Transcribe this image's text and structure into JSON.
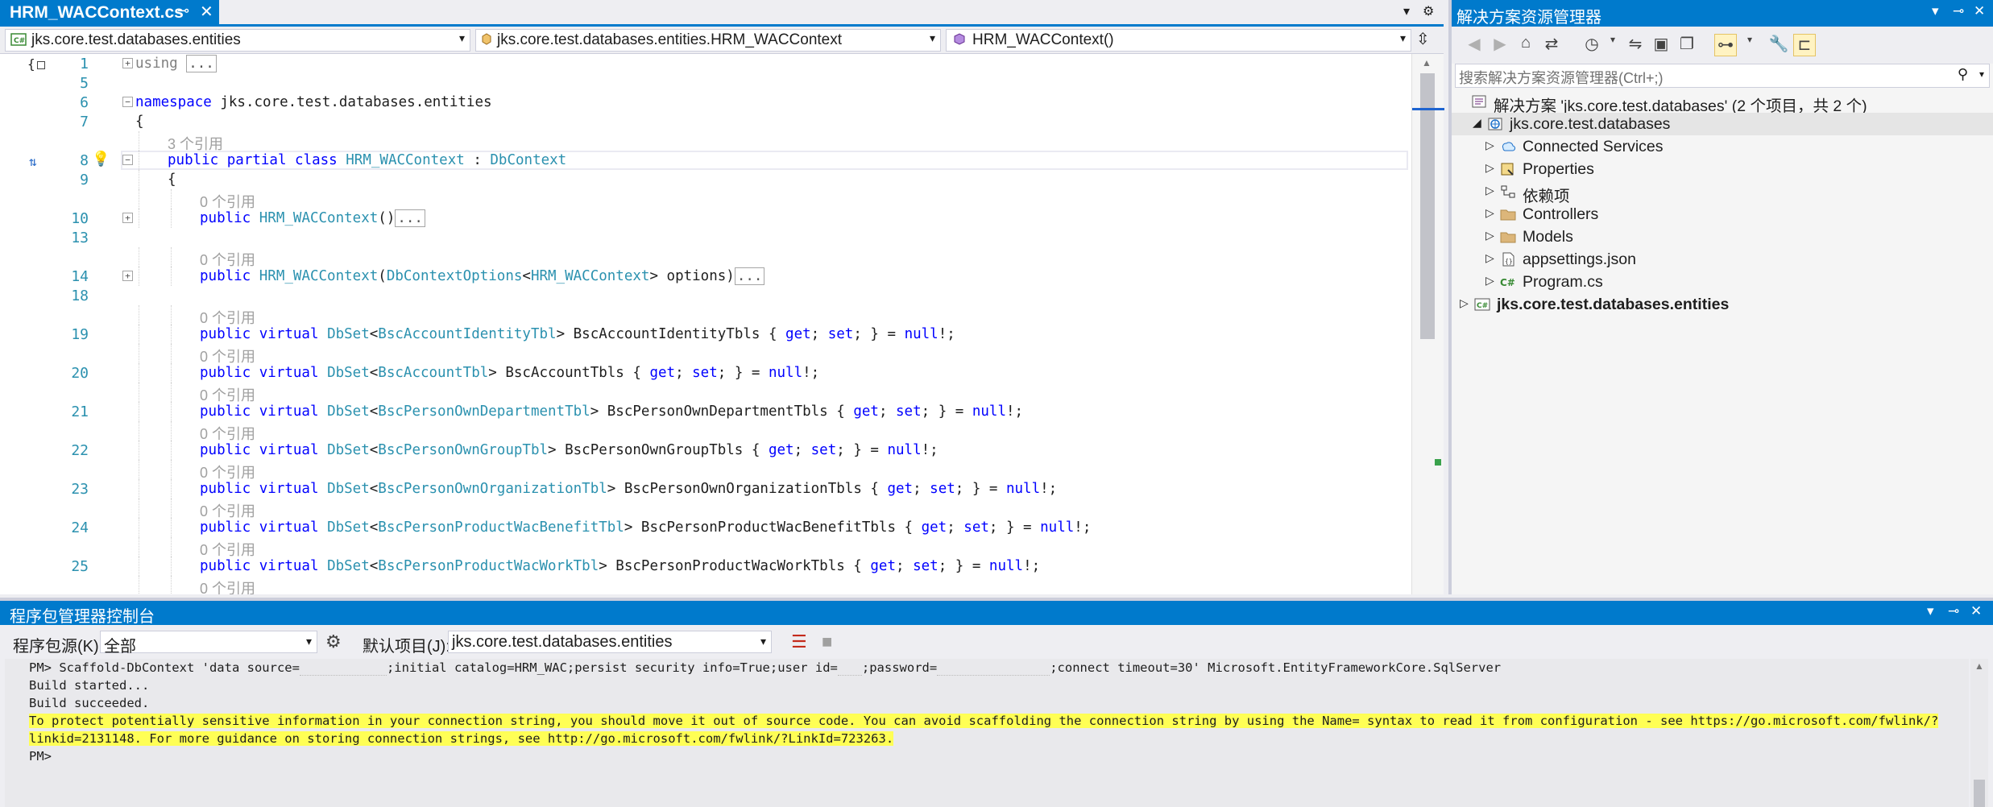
{
  "editor": {
    "tab_title": "HRM_WACContext.cs",
    "nav_project": "jks.core.test.databases.entities",
    "nav_class": "jks.core.test.databases.entities.HRM_WACContext",
    "nav_member": "HRM_WACContext()",
    "lines": [
      {
        "num": "1",
        "kind": "code",
        "fold": "+",
        "html_parts": [
          {
            "c": "dim",
            "t": "using "
          },
          {
            "c": "collapsed",
            "t": "..."
          }
        ]
      },
      {
        "num": "5",
        "kind": "blank"
      },
      {
        "num": "6",
        "kind": "code",
        "fold": "-",
        "html_parts": [
          {
            "c": "kw",
            "t": "namespace"
          },
          {
            "c": "",
            "t": " jks.core.test.databases.entities"
          }
        ]
      },
      {
        "num": "7",
        "kind": "code",
        "html_parts": [
          {
            "c": "",
            "t": "{"
          }
        ]
      },
      {
        "kind": "refs",
        "indent": 1,
        "text": "3 个引用"
      },
      {
        "num": "8",
        "kind": "code",
        "fold": "-",
        "current": true,
        "indent": 1,
        "html_parts": [
          {
            "c": "kw",
            "t": "public partial class"
          },
          {
            "c": "",
            "t": " "
          },
          {
            "c": "ty",
            "t": "HRM_WACContext"
          },
          {
            "c": "",
            "t": " : "
          },
          {
            "c": "ty",
            "t": "DbContext"
          }
        ]
      },
      {
        "num": "9",
        "kind": "code",
        "indent": 1,
        "html_parts": [
          {
            "c": "",
            "t": "{"
          }
        ]
      },
      {
        "kind": "refs",
        "indent": 2,
        "text": "0 个引用"
      },
      {
        "num": "10",
        "kind": "code",
        "fold": "+",
        "indent": 2,
        "html_parts": [
          {
            "c": "kw",
            "t": "public"
          },
          {
            "c": "",
            "t": " "
          },
          {
            "c": "ty",
            "t": "HRM_WACContext"
          },
          {
            "c": "",
            "t": "()"
          },
          {
            "c": "collapsed",
            "t": "..."
          }
        ]
      },
      {
        "num": "13",
        "kind": "blank"
      },
      {
        "kind": "refs",
        "indent": 2,
        "text": "0 个引用"
      },
      {
        "num": "14",
        "kind": "code",
        "fold": "+",
        "indent": 2,
        "html_parts": [
          {
            "c": "kw",
            "t": "public"
          },
          {
            "c": "",
            "t": " "
          },
          {
            "c": "ty",
            "t": "HRM_WACContext"
          },
          {
            "c": "",
            "t": "("
          },
          {
            "c": "ty",
            "t": "DbContextOptions"
          },
          {
            "c": "",
            "t": "<"
          },
          {
            "c": "ty",
            "t": "HRM_WACContext"
          },
          {
            "c": "",
            "t": "> options)"
          },
          {
            "c": "collapsed",
            "t": "..."
          }
        ]
      },
      {
        "num": "18",
        "kind": "blank"
      },
      {
        "kind": "refs",
        "indent": 2,
        "text": "0 个引用"
      },
      {
        "num": "19",
        "kind": "code",
        "indent": 2,
        "html_parts": [
          {
            "c": "kw",
            "t": "public virtual"
          },
          {
            "c": "",
            "t": " "
          },
          {
            "c": "ty",
            "t": "DbSet"
          },
          {
            "c": "",
            "t": "<"
          },
          {
            "c": "ty",
            "t": "BscAccountIdentityTbl"
          },
          {
            "c": "",
            "t": "> BscAccountIdentityTbls { "
          },
          {
            "c": "kw",
            "t": "get"
          },
          {
            "c": "",
            "t": "; "
          },
          {
            "c": "kw",
            "t": "set"
          },
          {
            "c": "",
            "t": "; } = "
          },
          {
            "c": "kw",
            "t": "null"
          },
          {
            "c": "",
            "t": "!;"
          }
        ]
      },
      {
        "kind": "refs",
        "indent": 2,
        "text": "0 个引用"
      },
      {
        "num": "20",
        "kind": "code",
        "indent": 2,
        "html_parts": [
          {
            "c": "kw",
            "t": "public virtual"
          },
          {
            "c": "",
            "t": " "
          },
          {
            "c": "ty",
            "t": "DbSet"
          },
          {
            "c": "",
            "t": "<"
          },
          {
            "c": "ty",
            "t": "BscAccountTbl"
          },
          {
            "c": "",
            "t": "> BscAccountTbls { "
          },
          {
            "c": "kw",
            "t": "get"
          },
          {
            "c": "",
            "t": "; "
          },
          {
            "c": "kw",
            "t": "set"
          },
          {
            "c": "",
            "t": "; } = "
          },
          {
            "c": "kw",
            "t": "null"
          },
          {
            "c": "",
            "t": "!;"
          }
        ]
      },
      {
        "kind": "refs",
        "indent": 2,
        "text": "0 个引用"
      },
      {
        "num": "21",
        "kind": "code",
        "indent": 2,
        "html_parts": [
          {
            "c": "kw",
            "t": "public virtual"
          },
          {
            "c": "",
            "t": " "
          },
          {
            "c": "ty",
            "t": "DbSet"
          },
          {
            "c": "",
            "t": "<"
          },
          {
            "c": "ty",
            "t": "BscPersonOwnDepartmentTbl"
          },
          {
            "c": "",
            "t": "> BscPersonOwnDepartmentTbls { "
          },
          {
            "c": "kw",
            "t": "get"
          },
          {
            "c": "",
            "t": "; "
          },
          {
            "c": "kw",
            "t": "set"
          },
          {
            "c": "",
            "t": "; } = "
          },
          {
            "c": "kw",
            "t": "null"
          },
          {
            "c": "",
            "t": "!;"
          }
        ]
      },
      {
        "kind": "refs",
        "indent": 2,
        "text": "0 个引用"
      },
      {
        "num": "22",
        "kind": "code",
        "indent": 2,
        "html_parts": [
          {
            "c": "kw",
            "t": "public virtual"
          },
          {
            "c": "",
            "t": " "
          },
          {
            "c": "ty",
            "t": "DbSet"
          },
          {
            "c": "",
            "t": "<"
          },
          {
            "c": "ty",
            "t": "BscPersonOwnGroupTbl"
          },
          {
            "c": "",
            "t": "> BscPersonOwnGroupTbls { "
          },
          {
            "c": "kw",
            "t": "get"
          },
          {
            "c": "",
            "t": "; "
          },
          {
            "c": "kw",
            "t": "set"
          },
          {
            "c": "",
            "t": "; } = "
          },
          {
            "c": "kw",
            "t": "null"
          },
          {
            "c": "",
            "t": "!;"
          }
        ]
      },
      {
        "kind": "refs",
        "indent": 2,
        "text": "0 个引用"
      },
      {
        "num": "23",
        "kind": "code",
        "indent": 2,
        "html_parts": [
          {
            "c": "kw",
            "t": "public virtual"
          },
          {
            "c": "",
            "t": " "
          },
          {
            "c": "ty",
            "t": "DbSet"
          },
          {
            "c": "",
            "t": "<"
          },
          {
            "c": "ty",
            "t": "BscPersonOwnOrganizationTbl"
          },
          {
            "c": "",
            "t": "> BscPersonOwnOrganizationTbls { "
          },
          {
            "c": "kw",
            "t": "get"
          },
          {
            "c": "",
            "t": "; "
          },
          {
            "c": "kw",
            "t": "set"
          },
          {
            "c": "",
            "t": "; } = "
          },
          {
            "c": "kw",
            "t": "null"
          },
          {
            "c": "",
            "t": "!;"
          }
        ]
      },
      {
        "kind": "refs",
        "indent": 2,
        "text": "0 个引用"
      },
      {
        "num": "24",
        "kind": "code",
        "indent": 2,
        "html_parts": [
          {
            "c": "kw",
            "t": "public virtual"
          },
          {
            "c": "",
            "t": " "
          },
          {
            "c": "ty",
            "t": "DbSet"
          },
          {
            "c": "",
            "t": "<"
          },
          {
            "c": "ty",
            "t": "BscPersonProductWacBenefitTbl"
          },
          {
            "c": "",
            "t": "> BscPersonProductWacBenefitTbls { "
          },
          {
            "c": "kw",
            "t": "get"
          },
          {
            "c": "",
            "t": "; "
          },
          {
            "c": "kw",
            "t": "set"
          },
          {
            "c": "",
            "t": "; } = "
          },
          {
            "c": "kw",
            "t": "null"
          },
          {
            "c": "",
            "t": "!;"
          }
        ]
      },
      {
        "kind": "refs",
        "indent": 2,
        "text": "0 个引用"
      },
      {
        "num": "25",
        "kind": "code",
        "indent": 2,
        "html_parts": [
          {
            "c": "kw",
            "t": "public virtual"
          },
          {
            "c": "",
            "t": " "
          },
          {
            "c": "ty",
            "t": "DbSet"
          },
          {
            "c": "",
            "t": "<"
          },
          {
            "c": "ty",
            "t": "BscPersonProductWacWorkTbl"
          },
          {
            "c": "",
            "t": "> BscPersonProductWacWorkTbls { "
          },
          {
            "c": "kw",
            "t": "get"
          },
          {
            "c": "",
            "t": "; "
          },
          {
            "c": "kw",
            "t": "set"
          },
          {
            "c": "",
            "t": "; } = "
          },
          {
            "c": "kw",
            "t": "null"
          },
          {
            "c": "",
            "t": "!;"
          }
        ]
      },
      {
        "kind": "refs",
        "indent": 2,
        "text": "0 个引用"
      }
    ]
  },
  "solution_explorer": {
    "title": "解决方案资源管理器",
    "search_placeholder": "搜索解决方案资源管理器(Ctrl+;)",
    "tree": [
      {
        "label": "解决方案 'jks.core.test.databases' (2 个项目，共 2 个)",
        "level": 0,
        "icon": "solution-icon",
        "expander": "",
        "bold": false
      },
      {
        "label": "jks.core.test.databases",
        "level": 0,
        "icon": "web-project-icon",
        "expander": "◢",
        "bold": false,
        "selected": true
      },
      {
        "label": "Connected Services",
        "level": 1,
        "icon": "connected-services-icon",
        "expander": "▷",
        "bold": false
      },
      {
        "label": "Properties",
        "level": 1,
        "icon": "properties-icon",
        "expander": "▷",
        "bold": false
      },
      {
        "label": "依赖项",
        "level": 1,
        "icon": "dependencies-icon",
        "expander": "▷",
        "bold": false
      },
      {
        "label": "Controllers",
        "level": 1,
        "icon": "folder-icon",
        "expander": "▷",
        "bold": false
      },
      {
        "label": "Models",
        "level": 1,
        "icon": "folder-icon",
        "expander": "▷",
        "bold": false
      },
      {
        "label": "appsettings.json",
        "level": 1,
        "icon": "json-file-icon",
        "expander": "▷",
        "bold": false
      },
      {
        "label": "Program.cs",
        "level": 1,
        "icon": "csharp-file-icon",
        "expander": "▷",
        "bold": false
      },
      {
        "label": "jks.core.test.databases.entities",
        "level": -1,
        "icon": "csharp-project-icon",
        "expander": "▷",
        "bold": true
      }
    ]
  },
  "pmc": {
    "title": "程序包管理器控制台",
    "source_label": "程序包源(K):",
    "source_value": "全部",
    "default_project_label": "默认项目(J):",
    "default_project_value": "jks.core.test.databases.entities",
    "output": {
      "cmd_a": "PM> Scaffold-DbContext 'data source=",
      "cmd_b": ";initial catalog=HRM_WAC;persist security info=True;user id=",
      "cmd_c": ";password=",
      "cmd_d": ";connect timeout=30' Microsoft.EntityFrameworkCore.SqlServer",
      "line2": "Build started...",
      "line3": "Build succeeded.",
      "warn1": "To protect potentially sensitive information in your connection string, you should move it out of source code. You can avoid scaffolding the connection string by using the Name= syntax to read it from configuration - see https://go.microsoft.com/fwlink/?",
      "warn2": "linkid=2131148. For more guidance on storing connection strings, see http://go.microsoft.com/fwlink/?LinkId=723263.",
      "prompt": "PM>"
    }
  }
}
